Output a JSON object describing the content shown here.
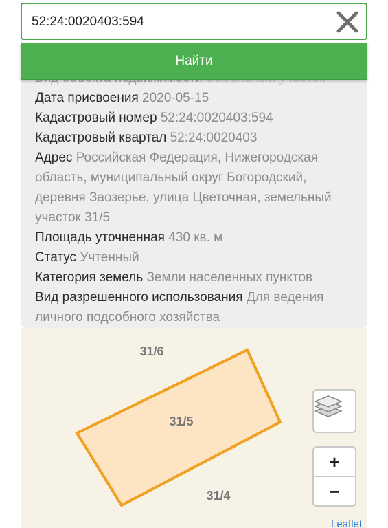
{
  "search": {
    "value": "52:24:0020403:594",
    "placeholder": ""
  },
  "find_button": {
    "label": "Найти"
  },
  "info": {
    "rows": [
      {
        "label": "Вид объекта недвижимости",
        "value": "Земельный участок"
      },
      {
        "label": "Дата присвоения",
        "value": "2020-05-15"
      },
      {
        "label": "Кадастровый номер",
        "value": "52:24:0020403:594"
      },
      {
        "label": "Кадастровый квартал",
        "value": "52:24:0020403"
      },
      {
        "label": "Адрес",
        "value": "Российская Федерация, Нижегородская область, муниципальный округ Богородский, деревня Заозерье, улица Цветочная, земельный участок 31/5"
      },
      {
        "label": "Площадь уточненная",
        "value": "430 кв. м"
      },
      {
        "label": "Статус",
        "value": "Учтенный"
      },
      {
        "label": "Категория земель",
        "value": "Земли населенных пунктов"
      },
      {
        "label": "Вид разрешенного использования",
        "value": "Для ведения личного подсобного хозяйства"
      }
    ]
  },
  "map": {
    "parcels": {
      "north": "31/6",
      "selected": "31/5",
      "south": "31/4"
    },
    "selected_fill": "#fde4c3",
    "selected_stroke": "#f0a022",
    "background": "#f6f3e6",
    "controls": {
      "layers_icon": "layers-icon",
      "zoom_in": "+",
      "zoom_out": "−"
    },
    "attribution": "Leaflet"
  },
  "colors": {
    "accent": "#4caf50",
    "panel_bg": "#eeeeee",
    "value_text": "#8c8c8c"
  }
}
